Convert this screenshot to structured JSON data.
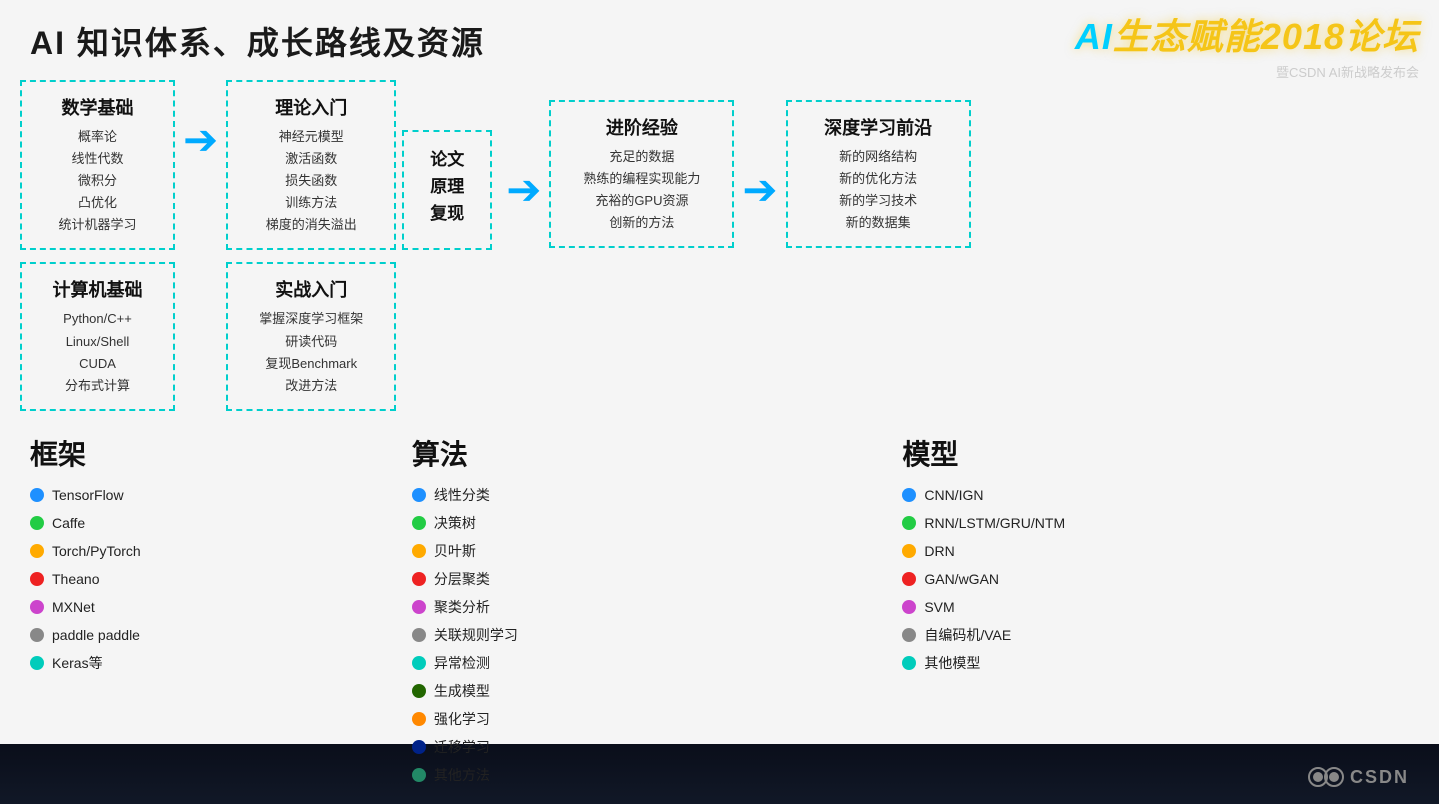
{
  "page": {
    "title": "AI 知识体系、成长路线及资源",
    "logo": {
      "main": "AI生态赋能2018论坛",
      "sub": "暨CSDN AI新战略发布会",
      "ai_prefix": "AI",
      "rest": "生态赋能2018论坛"
    }
  },
  "flow": {
    "box1": {
      "section1_title": "数学基础",
      "section1_items": [
        "概率论",
        "线性代数",
        "微积分",
        "凸优化",
        "统计机器学习"
      ],
      "section2_title": "计算机基础",
      "section2_items": [
        "Python/C++",
        "Linux/Shell",
        "CUDA",
        "分布式计算"
      ]
    },
    "arrow1": "→",
    "box2": {
      "section1_title": "理论入门",
      "section1_items": [
        "神经元模型",
        "激活函数",
        "损失函数",
        "训练方法",
        "梯度的消失溢出"
      ],
      "section2_title": "实战入门",
      "section2_items": [
        "掌握深度学习框架",
        "研读代码",
        "复现Benchmark",
        "改进方法"
      ]
    },
    "paper_box": {
      "title": "论文\n原理\n复现"
    },
    "arrow2": "→",
    "box3": {
      "title": "进阶经验",
      "items": [
        "充足的数据",
        "熟练的编程实现能力",
        "充裕的GPU资源",
        "创新的方法"
      ]
    },
    "arrow3": "→",
    "box4": {
      "title": "深度学习前沿",
      "items": [
        "新的网络结构",
        "新的优化方法",
        "新的学习技术",
        "新的数据集"
      ]
    }
  },
  "bottom": {
    "frameworks": {
      "title": "框架",
      "items": [
        {
          "name": "TensorFlow",
          "color": "#1e90ff"
        },
        {
          "name": "Caffe",
          "color": "#22cc44"
        },
        {
          "name": "Torch/PyTorch",
          "color": "#ffaa00"
        },
        {
          "name": "Theano",
          "color": "#ee2222"
        },
        {
          "name": "MXNet",
          "color": "#cc44cc"
        },
        {
          "name": "paddle paddle",
          "color": "#888888"
        },
        {
          "name": "Keras等",
          "color": "#00ccbb"
        }
      ]
    },
    "algorithms": {
      "title": "算法",
      "items": [
        {
          "name": "线性分类",
          "color": "#1e90ff"
        },
        {
          "name": "决策树",
          "color": "#22cc44"
        },
        {
          "name": "贝叶斯",
          "color": "#ffaa00"
        },
        {
          "name": "分层聚类",
          "color": "#ee2222"
        },
        {
          "name": "聚类分析",
          "color": "#cc44cc"
        },
        {
          "name": "关联规则学习",
          "color": "#888888"
        },
        {
          "name": "异常检测",
          "color": "#00ccbb"
        },
        {
          "name": "生成模型",
          "color": "#226600"
        },
        {
          "name": "强化学习",
          "color": "#ff8800"
        },
        {
          "name": "迁移学习",
          "color": "#002288"
        },
        {
          "name": "其他方法",
          "color": "#228866"
        }
      ]
    },
    "models": {
      "title": "模型",
      "items": [
        {
          "name": "CNN/IGN",
          "color": "#1e90ff"
        },
        {
          "name": "RNN/LSTM/GRU/NTM",
          "color": "#22cc44"
        },
        {
          "name": "DRN",
          "color": "#ffaa00"
        },
        {
          "name": "GAN/wGAN",
          "color": "#ee2222"
        },
        {
          "name": "SVM",
          "color": "#cc44cc"
        },
        {
          "name": "自编码机/VAE",
          "color": "#888888"
        },
        {
          "name": "其他模型",
          "color": "#00ccbb"
        }
      ]
    }
  },
  "csdn": {
    "label": "CSDN"
  }
}
